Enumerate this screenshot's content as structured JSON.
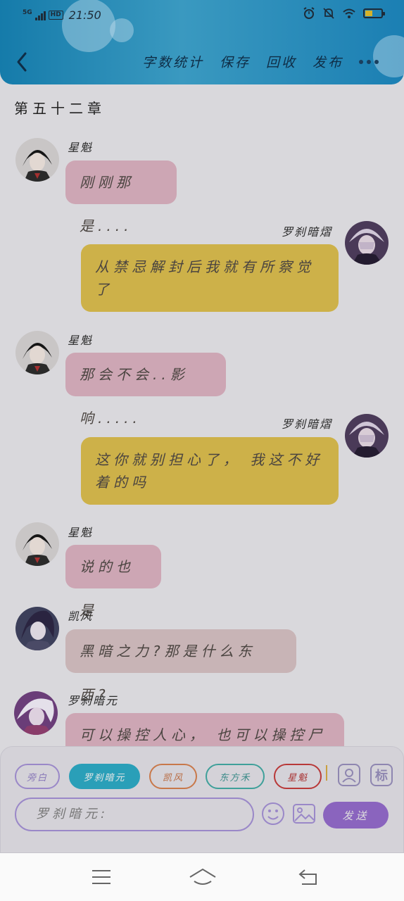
{
  "status_bar": {
    "network": "5G",
    "hd": "HD",
    "time": "21:50"
  },
  "header": {
    "nav": [
      "字数统计",
      "保存",
      "回收",
      "发布"
    ],
    "icons": {
      "back": "chevron-left-icon",
      "more": "more-dots-icon"
    }
  },
  "chapter": {
    "title": "第五十二章"
  },
  "messages": [
    {
      "name": "星魁",
      "text": "刚刚那是...."
    },
    {
      "name": "罗刹暗熠",
      "text": "从禁忌解封后我就有所察觉了"
    },
    {
      "name": "星魁",
      "text": "那会不会..影响....."
    },
    {
      "name": "罗刹暗熠",
      "text": "这你就别担心了， 我这不好着的吗"
    },
    {
      "name": "星魁",
      "text": "说的也是"
    },
    {
      "name": "凯风",
      "text": "黑暗之力?那是什么东西?"
    },
    {
      "name": "罗刹暗元",
      "text": "可以操控人心， 也可以操控尸人"
    }
  ],
  "composer": {
    "roles": [
      "旁白",
      "罗刹暗元",
      "凯风",
      "东方禾",
      "星魁"
    ],
    "tool_icons": [
      "person-icon",
      "tag-icon",
      "emoji-icon",
      "image-icon"
    ],
    "tag_label": "标",
    "input_value": "罗刹暗元:",
    "send_label": "发送"
  },
  "colors": {
    "header_blue": "#1b7fb3",
    "bubble_left": "#cda6b4",
    "bubble_right": "#cdb149",
    "send": "#8a64be"
  }
}
